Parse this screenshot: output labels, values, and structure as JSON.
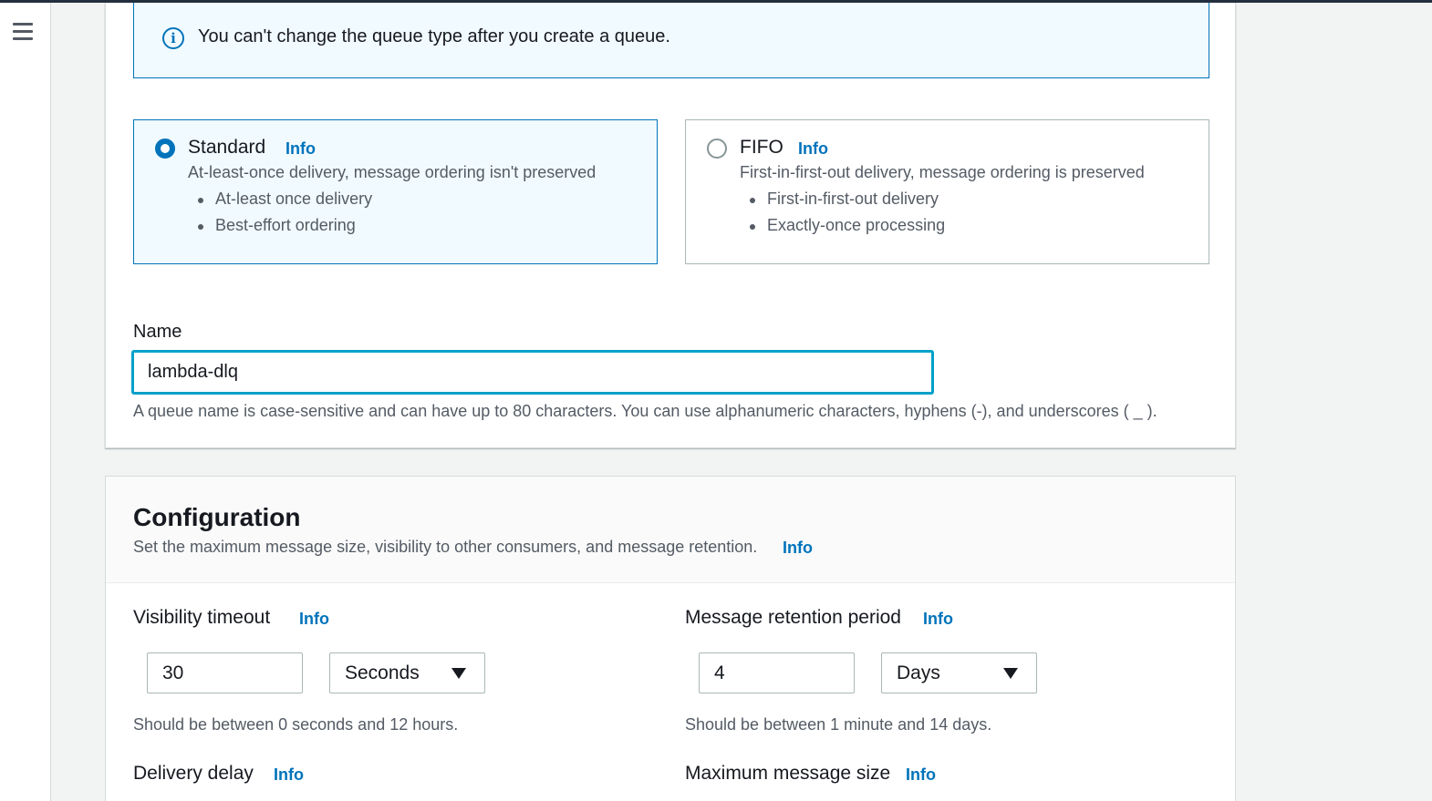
{
  "nav": {
    "menu_icon": "hamburger-menu-icon"
  },
  "alert": {
    "icon": "info-circle-icon",
    "text": "You can't change the queue type after you create a queue."
  },
  "queue_types": [
    {
      "title": "Standard",
      "info": "Info",
      "selected": true,
      "description": "At-least-once delivery, message ordering isn't preserved",
      "bullets": [
        "At-least once delivery",
        "Best-effort ordering"
      ]
    },
    {
      "title": "FIFO",
      "info": "Info",
      "selected": false,
      "description": "First-in-first-out delivery, message ordering is preserved",
      "bullets": [
        "First-in-first-out delivery",
        "Exactly-once processing"
      ]
    }
  ],
  "name": {
    "label": "Name",
    "value": "lambda-dlq",
    "help": "A queue name is case-sensitive and can have up to 80 characters. You can use alphanumeric characters, hyphens (-), and underscores ( _ )."
  },
  "configuration": {
    "title": "Configuration",
    "description": "Set the maximum message size, visibility to other consumers, and message retention.",
    "info": "Info",
    "visibility_timeout": {
      "label": "Visibility timeout",
      "info": "Info",
      "value": "30",
      "unit": "Seconds",
      "help": "Should be between 0 seconds and 12 hours."
    },
    "message_retention": {
      "label": "Message retention period",
      "info": "Info",
      "value": "4",
      "unit": "Days",
      "help": "Should be between 1 minute and 14 days."
    },
    "delivery_delay": {
      "label": "Delivery delay",
      "info": "Info"
    },
    "max_message_size": {
      "label": "Maximum message size",
      "info": "Info"
    }
  },
  "colors": {
    "accent": "#0073bb",
    "focus": "#00a1c9",
    "selected_bg": "#f1faff"
  }
}
